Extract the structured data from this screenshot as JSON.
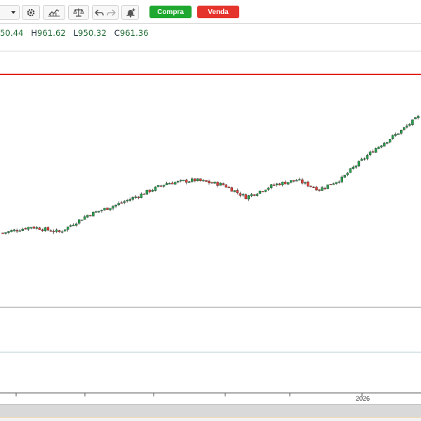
{
  "toolbar": {
    "compra_label": "Compra",
    "venda_label": "Venda",
    "colors": {
      "compra": "#1fa82f",
      "venda": "#e5342b"
    }
  },
  "ohlc": {
    "open_value": "50.44",
    "high_key": "H",
    "high_value": "961.62",
    "low_key": "L",
    "low_value": "950.32",
    "close_key": "C",
    "close_value": "961.36"
  },
  "chart_data": {
    "type": "candlestick",
    "x_tick_label": "2026",
    "price_line_color": "#e0241b",
    "up_color": "#26a04a",
    "down_color": "#e23c35",
    "approx_price_path": [
      {
        "bar": 0,
        "price": 812
      },
      {
        "bar": 10,
        "price": 820
      },
      {
        "bar": 20,
        "price": 813
      },
      {
        "bar": 30,
        "price": 835
      },
      {
        "bar": 40,
        "price": 848
      },
      {
        "bar": 48,
        "price": 860
      },
      {
        "bar": 58,
        "price": 876
      },
      {
        "bar": 68,
        "price": 880
      },
      {
        "bar": 78,
        "price": 874
      },
      {
        "bar": 86,
        "price": 858
      },
      {
        "bar": 96,
        "price": 874
      },
      {
        "bar": 104,
        "price": 880
      },
      {
        "bar": 112,
        "price": 868
      },
      {
        "bar": 120,
        "price": 882
      },
      {
        "bar": 124,
        "price": 896
      },
      {
        "bar": 132,
        "price": 921
      },
      {
        "bar": 140,
        "price": 941
      },
      {
        "bar": 147,
        "price": 961
      }
    ]
  }
}
